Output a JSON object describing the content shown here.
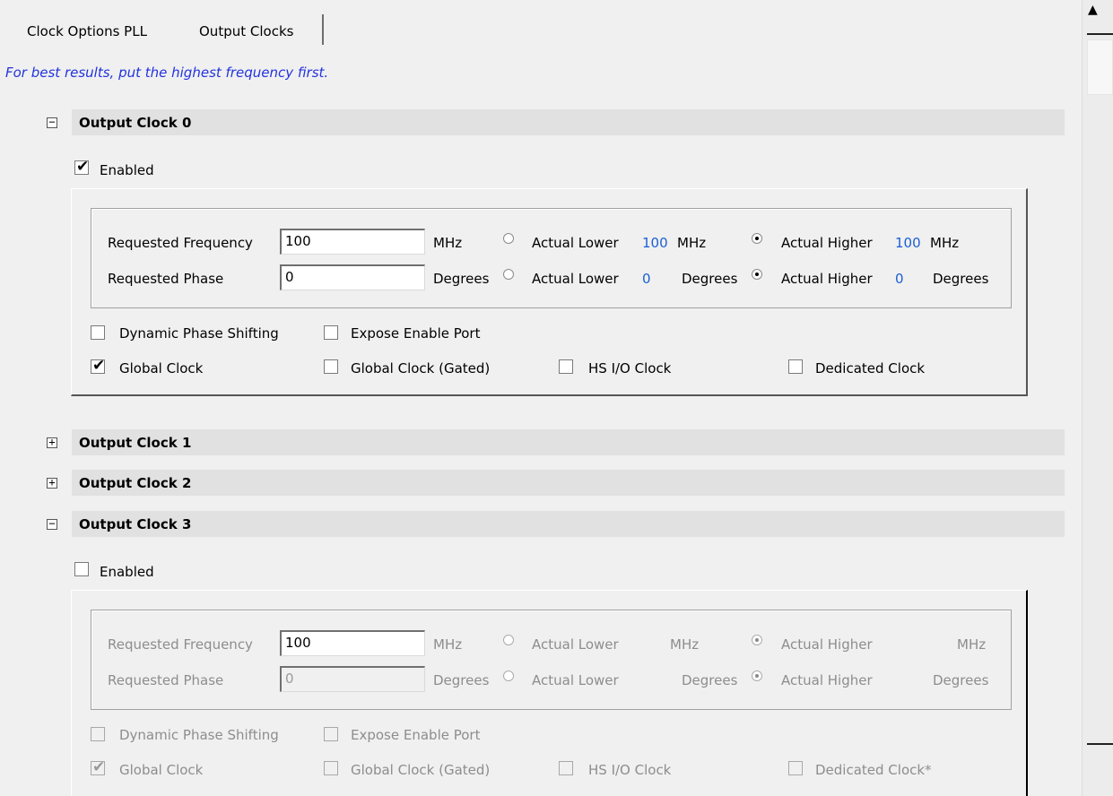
{
  "tabs": [
    {
      "label": "Clock Options PLL",
      "active": false
    },
    {
      "label": "Output Clocks",
      "active": true
    }
  ],
  "hint": "For best results, put the highest frequency first.",
  "output_clocks": [
    {
      "title": "Output Clock 0",
      "expanded": true,
      "enabled": true,
      "enabled_label": "Enabled",
      "freq_label": "Requested Frequency",
      "freq_value": "100",
      "freq_unit": "MHz",
      "freq_actual_lower_label": "Actual Lower",
      "freq_actual_lower_value": "100",
      "freq_actual_lower_unit": "MHz",
      "freq_actual_higher_label": "Actual Higher",
      "freq_actual_higher_value": "100",
      "freq_actual_higher_unit": "MHz",
      "phase_label": "Requested Phase",
      "phase_value": "0",
      "phase_unit": "Degrees",
      "phase_actual_lower_label": "Actual Lower",
      "phase_actual_lower_value": "0",
      "phase_actual_lower_unit": "Degrees",
      "phase_actual_higher_label": "Actual Higher",
      "phase_actual_higher_value": "0",
      "phase_actual_higher_unit": "Degrees",
      "selected_actual": "higher",
      "dynamic_phase_shifting": {
        "label": "Dynamic Phase Shifting",
        "checked": false
      },
      "expose_enable_port": {
        "label": "Expose Enable Port",
        "checked": false
      },
      "global_clock": {
        "label": "Global Clock",
        "checked": true
      },
      "global_clock_gated": {
        "label": "Global Clock (Gated)",
        "checked": false
      },
      "hs_io_clock": {
        "label": "HS I/O Clock",
        "checked": false
      },
      "dedicated_clock": {
        "label": "Dedicated Clock",
        "checked": false
      }
    },
    {
      "title": "Output Clock 1",
      "expanded": false
    },
    {
      "title": "Output Clock 2",
      "expanded": false
    },
    {
      "title": "Output Clock 3",
      "expanded": true,
      "enabled": false,
      "enabled_label": "Enabled",
      "freq_label": "Requested Frequency",
      "freq_value": "100",
      "freq_unit": "MHz",
      "freq_actual_lower_label": "Actual Lower",
      "freq_actual_lower_unit": "MHz",
      "freq_actual_higher_label": "Actual Higher",
      "freq_actual_higher_unit": "MHz",
      "phase_label": "Requested Phase",
      "phase_value": "0",
      "phase_unit": "Degrees",
      "phase_actual_lower_label": "Actual Lower",
      "phase_actual_lower_unit": "Degrees",
      "phase_actual_higher_label": "Actual Higher",
      "phase_actual_higher_unit": "Degrees",
      "selected_actual": "higher",
      "dynamic_phase_shifting": {
        "label": "Dynamic Phase Shifting",
        "checked": false
      },
      "expose_enable_port": {
        "label": "Expose Enable Port",
        "checked": false
      },
      "global_clock": {
        "label": "Global Clock",
        "checked": true
      },
      "global_clock_gated": {
        "label": "Global Clock (Gated)",
        "checked": false
      },
      "hs_io_clock": {
        "label": "HS I/O Clock",
        "checked": false
      },
      "dedicated_clock": {
        "label": "Dedicated Clock*",
        "checked": false
      }
    }
  ],
  "icons": {
    "collapse": "minus-box-icon",
    "expand": "plus-box-icon",
    "check": "checkmark-icon",
    "scroll_up": "triangle-up-icon"
  },
  "colors": {
    "hint": "#2233dd",
    "actual_value": "#1b5fd4",
    "section_header": "#e1e1e1",
    "background": "#f0f0f0"
  }
}
